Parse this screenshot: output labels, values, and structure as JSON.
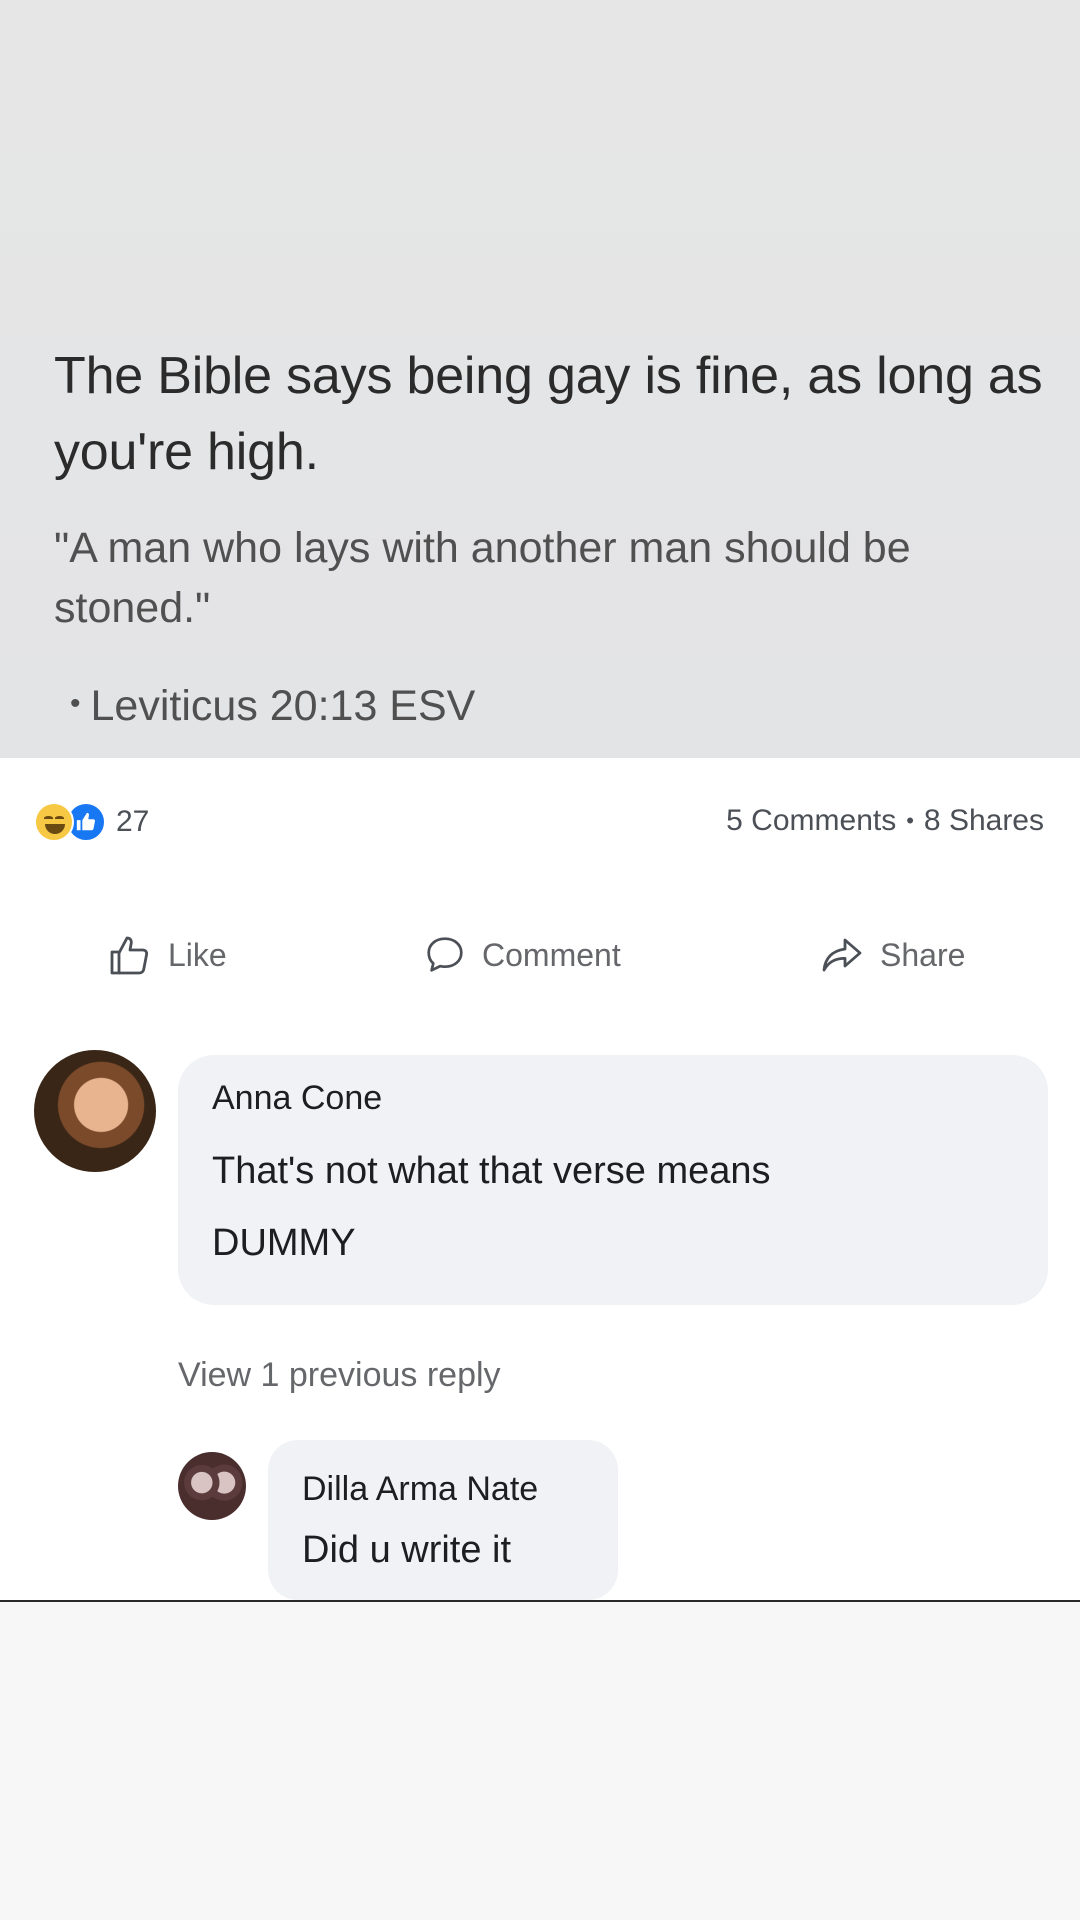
{
  "post": {
    "headline": "The Bible says being gay is fine, as long as you're high.",
    "quote": "\"A man who lays with another man should be stoned.\"",
    "citation_bullet": "•",
    "citation": "Leviticus 20:13 ESV"
  },
  "reactions": {
    "icons": [
      "haha-emoji-icon",
      "like-reaction-icon"
    ],
    "count": "27"
  },
  "stats": {
    "comments": "5 Comments",
    "separator": "•",
    "shares": "8 Shares"
  },
  "actions": {
    "like": "Like",
    "comment": "Comment",
    "share": "Share"
  },
  "comments": [
    {
      "author": "Anna Cone",
      "lines": [
        "That's not what that verse means",
        "DUMMY"
      ]
    }
  ],
  "view_replies": "View 1 previous reply",
  "replies": [
    {
      "author": "Dilla Arma Nate",
      "text": "Did u write it"
    }
  ],
  "colors": {
    "accent": "#1877f2",
    "meme_background": "#e4e5e6",
    "bubble": "#f0f2f5",
    "secondary_text": "#65676b"
  }
}
